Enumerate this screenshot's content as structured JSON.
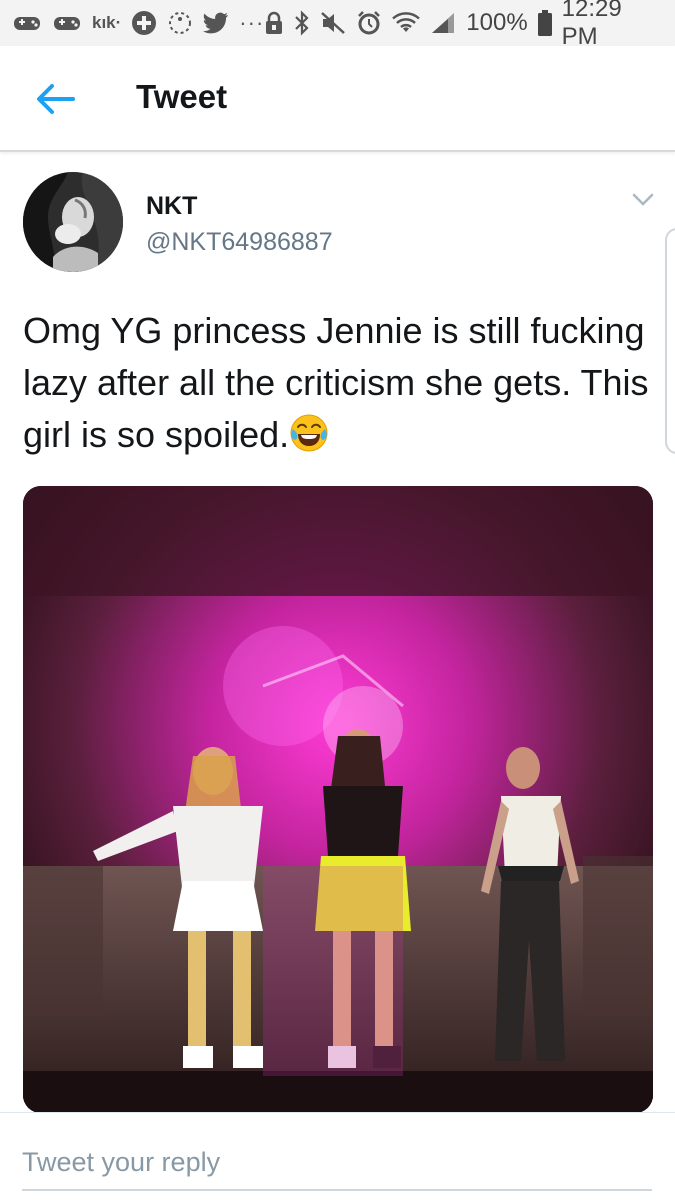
{
  "status_bar": {
    "kik_label": "kık·",
    "overflow_dots": "···",
    "battery_text": "100%",
    "time": "12:29 PM",
    "icons": [
      "gamepad-icon",
      "gamepad-icon",
      "kik-icon",
      "plus-icon",
      "spinner-icon",
      "twitter-icon",
      "lock-icon",
      "bluetooth-icon",
      "mute-icon",
      "alarm-icon",
      "wifi-icon",
      "signal-icon",
      "battery-icon"
    ]
  },
  "header": {
    "title": "Tweet",
    "back_icon": "back-arrow-icon",
    "accent_color": "#1da1f2"
  },
  "tweet": {
    "display_name": "NKT",
    "handle": "@NKT64986887",
    "text": "Omg YG princess Jennie is still fucking lazy after all the criticism she gets. This girl is so spoiled.",
    "emoji": "face-with-tears-of-joy",
    "menu_icon": "chevron-down-icon"
  },
  "reply": {
    "placeholder": "Tweet your reply"
  },
  "colors": {
    "text_primary": "#14171a",
    "text_secondary": "#657786",
    "accent": "#1da1f2",
    "divider": "#e1e8ed"
  }
}
